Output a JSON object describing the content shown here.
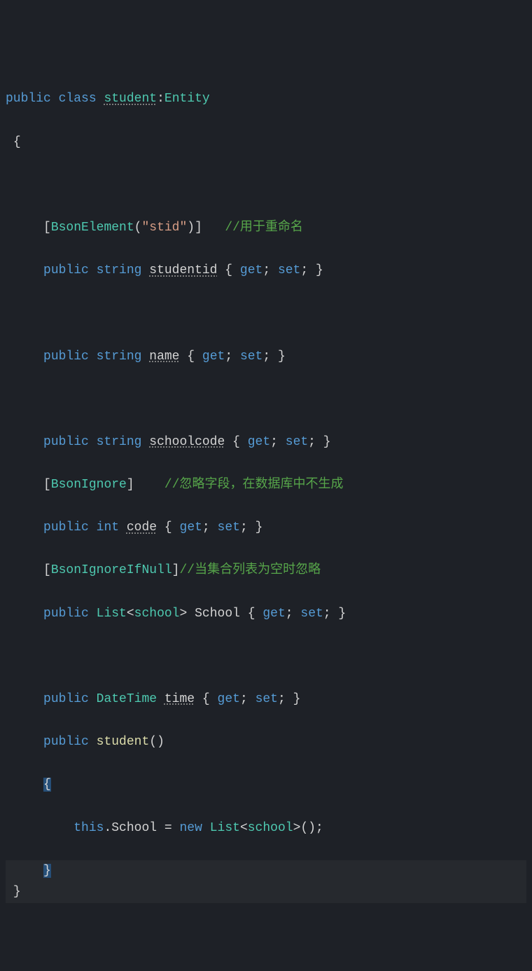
{
  "code": {
    "l1": {
      "public": "public",
      "class": "class",
      "student": "student",
      "colon": ":",
      "entity": "Entity"
    },
    "l2": {
      "brace": "{"
    },
    "l4": {
      "lbr": "[",
      "attr": "BsonElement",
      "lp": "(",
      "str": "\"stid\"",
      "rp": ")",
      "rbr": "]",
      "comment": "//用于重命名"
    },
    "l5": {
      "public": "public",
      "type": "string",
      "name": "studentid",
      "lb": "{",
      "get": "get",
      "sc1": ";",
      "set": "set",
      "sc2": ";",
      "rb": "}"
    },
    "l7": {
      "public": "public",
      "type": "string",
      "name": "name",
      "lb": "{",
      "get": "get",
      "sc1": ";",
      "set": "set",
      "sc2": ";",
      "rb": "}"
    },
    "l9": {
      "public": "public",
      "type": "string",
      "name": "schoolcode",
      "lb": "{",
      "get": "get",
      "sc1": ";",
      "set": "set",
      "sc2": ";",
      "rb": "}"
    },
    "l10": {
      "lbr": "[",
      "attr": "BsonIgnore",
      "rbr": "]",
      "comment": "//忽略字段，在数据库中不生成"
    },
    "l11": {
      "public": "public",
      "type": "int",
      "name": "code",
      "lb": "{",
      "get": "get",
      "sc1": ";",
      "set": "set",
      "sc2": ";",
      "rb": "}"
    },
    "l12": {
      "lbr": "[",
      "attr": "BsonIgnoreIfNull",
      "rbr": "]",
      "comment": "//当集合列表为空时忽略"
    },
    "l13": {
      "public": "public",
      "type": "List",
      "lt": "<",
      "inner": "school",
      "gt": ">",
      "name": "School",
      "lb": "{",
      "get": "get",
      "sc1": ";",
      "set": "set",
      "sc2": ";",
      "rb": "}"
    },
    "l15": {
      "public": "public",
      "type": "DateTime",
      "name": "time",
      "lb": "{",
      "get": "get",
      "sc1": ";",
      "set": "set",
      "sc2": ";",
      "rb": "}"
    },
    "l16": {
      "public": "public",
      "name": "student",
      "lp": "(",
      "rp": ")"
    },
    "l17": {
      "brace": "{"
    },
    "l18": {
      "this": "this",
      "dot": ".",
      "prop": "School",
      "eq": "=",
      "new": "new",
      "type": "List",
      "lt": "<",
      "inner": "school",
      "gt": ">",
      "lp": "(",
      "rp": ")",
      "sc": ";"
    },
    "l19": {
      "brace": "}"
    },
    "l20": {
      "brace": "}"
    }
  }
}
